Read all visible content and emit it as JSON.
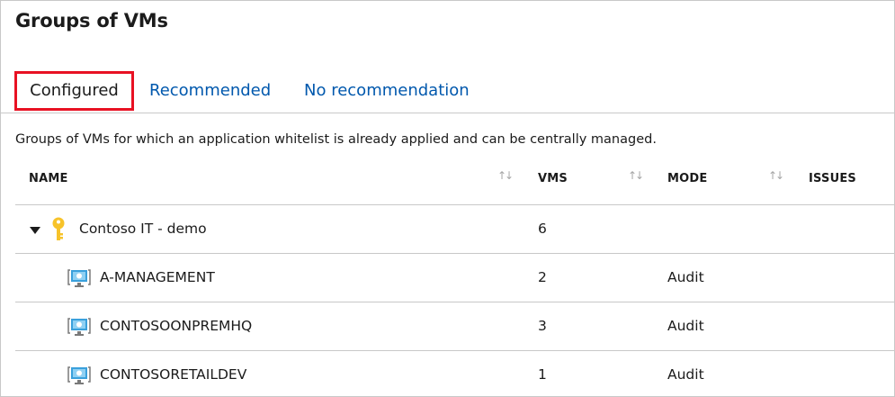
{
  "page": {
    "title": "Groups of VMs",
    "description": "Groups of VMs for which an application whitelist is already applied and can be centrally managed."
  },
  "tabs": [
    {
      "label": "Configured",
      "active": true
    },
    {
      "label": "Recommended",
      "active": false
    },
    {
      "label": "No recommendation",
      "active": false
    }
  ],
  "table": {
    "columns": {
      "name": "NAME",
      "vms": "VMS",
      "mode": "MODE",
      "issues": "ISSUES"
    },
    "sort_glyph": "↑↓",
    "group": {
      "name": "Contoso IT - demo",
      "vms": "6",
      "icon": "key-icon"
    },
    "rows": [
      {
        "name": "A-MANAGEMENT",
        "vms": "2",
        "mode": "Audit",
        "icon": "vm-icon"
      },
      {
        "name": "CONTOSOONPREMHQ",
        "vms": "3",
        "mode": "Audit",
        "icon": "vm-icon"
      },
      {
        "name": "CONTOSORETAILDEV",
        "vms": "1",
        "mode": "Audit",
        "icon": "vm-icon"
      }
    ]
  },
  "colors": {
    "active_tab_border": "#e81123",
    "link": "#0058ad",
    "divider": "#c8c8c8",
    "key_icon": "#f7c32a",
    "vm_icon": "#3aa0dc"
  }
}
